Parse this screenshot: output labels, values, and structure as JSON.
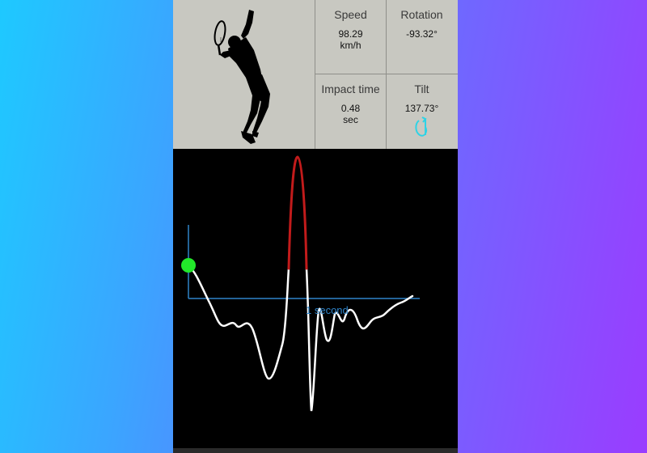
{
  "stats": {
    "speed": {
      "label": "Speed",
      "value": "98.29",
      "unit": "km/h"
    },
    "rotation": {
      "label": "Rotation",
      "value": "-93.32°"
    },
    "impact_time": {
      "label": "Impact time",
      "value": "0.48",
      "unit": "sec"
    },
    "tilt": {
      "label": "Tilt",
      "value": "137.73°",
      "icon": "rotate-icon"
    }
  },
  "graph": {
    "time_label": "1 second"
  },
  "colors": {
    "panel": "#c8c8c1",
    "accent_cyan": "#2dd3e6",
    "curve": "#ffffff",
    "highlight": "#c21b1b",
    "axis": "#2f84c9",
    "start_marker": "#22e82a"
  }
}
